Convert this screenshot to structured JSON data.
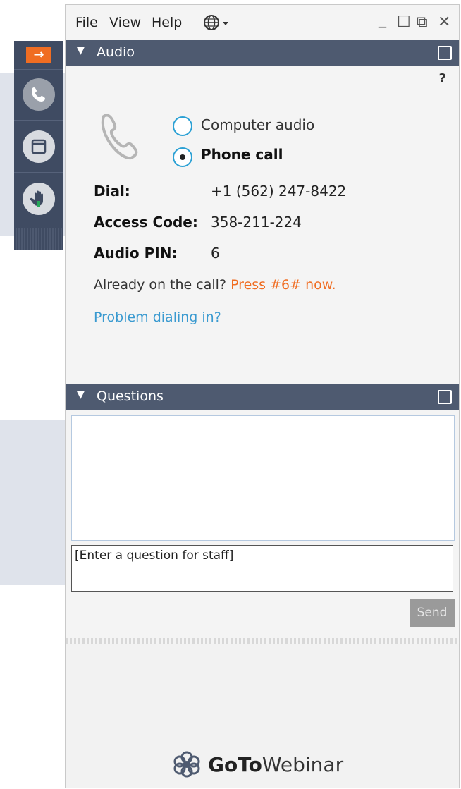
{
  "menu": {
    "file": "File",
    "view": "View",
    "help": "Help"
  },
  "window_controls": {
    "minimize": "_",
    "maximize": "☐",
    "restore": "⧉",
    "close": "✕"
  },
  "rail": {
    "arrow_icon": "arrow-right-icon",
    "items": [
      "phone-icon",
      "screen-icon",
      "raise-hand-icon"
    ],
    "accent": "#f06d22"
  },
  "audio": {
    "title": "Audio",
    "help": "?",
    "option_computer": "Computer audio",
    "option_phone": "Phone call",
    "selected": "Phone call",
    "dial_label": "Dial:",
    "dial_value": "+1 (562) 247-8422",
    "access_label": "Access Code:",
    "access_value": "358-211-224",
    "pin_label": "Audio PIN:",
    "pin_value": "6",
    "already_text": "Already on the call?",
    "press_text": "Press #6# now.",
    "problem_link": "Problem dialing in?"
  },
  "questions": {
    "title": "Questions",
    "input_text": "[Enter a question for staff]",
    "send_label": "Send"
  },
  "brand": {
    "goto": "GoTo",
    "webinar": "Webinar"
  },
  "colors": {
    "header": "#4e5a70",
    "accent": "#f06d22",
    "link": "#3a9ad0"
  }
}
